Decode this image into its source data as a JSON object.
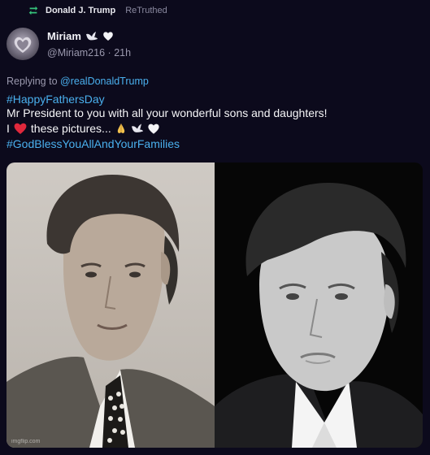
{
  "retruth": {
    "icon": "retruth-icon",
    "name": "Donald J. Trump",
    "label": "ReTruthed"
  },
  "author": {
    "display_name": "Miriam",
    "handle": "@Miriam216",
    "separator": "·",
    "time": "21h",
    "name_icons": [
      "dove-icon",
      "white-heart-icon"
    ]
  },
  "reply": {
    "prefix": "Replying to",
    "target": "@realDonaldTrump"
  },
  "body": {
    "hashtag1": "#HappyFathersDay",
    "line2": "Mr President to you with all your wonderful sons and daughters!",
    "line3_prefix": "I",
    "line3_text": "these pictures...",
    "hashtag2": "#GodBlessYouAllAndYourFamilies"
  },
  "media": {
    "watermark": "imgflip.com"
  },
  "colors": {
    "background": "#0c0a1c",
    "link": "#4ab0ee",
    "muted": "#9a98ad",
    "retruth_green": "#35c27a",
    "red_heart": "#e0283c"
  }
}
